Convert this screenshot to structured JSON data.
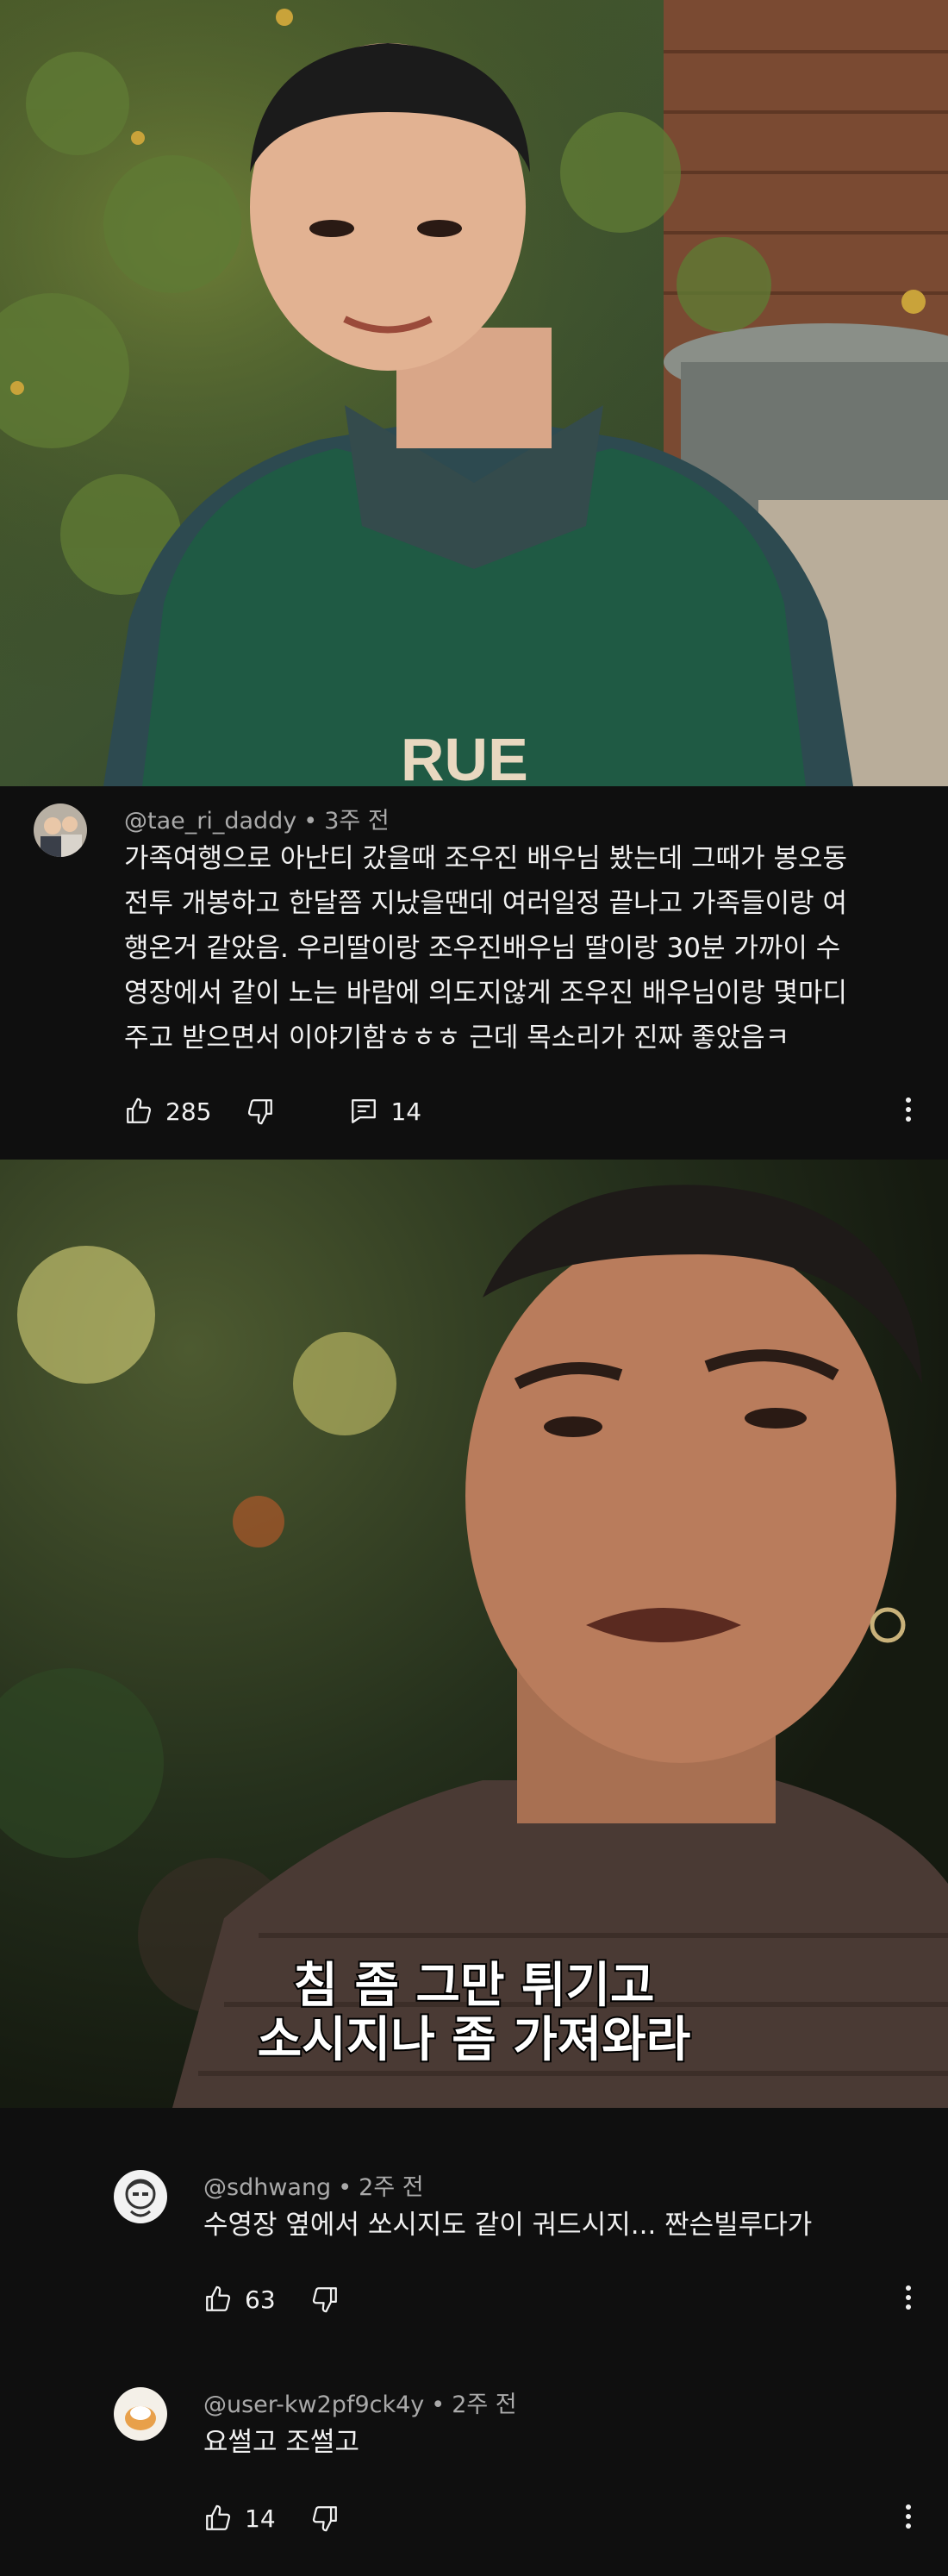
{
  "comments": [
    {
      "author": "@tae_ri_daddy",
      "time": "3주 전",
      "lines": [
        "가족여행으로 아난티 갔을때 조우진 배우님 봤는데 그때가 봉오동",
        "전투 개봉하고 한달쯤 지났을땐데 여러일정 끝나고 가족들이랑 여",
        "행온거 같았음. 우리딸이랑 조우진배우님 딸이랑 30분 가까이 수",
        "영장에서 같이 노는 바람에 의도지않게 조우진 배우님이랑 몇마디",
        "주고 받으면서 이야기함ㅎㅎㅎ 근데 목소리가 진짜 좋았음ㅋ"
      ],
      "likes": "285",
      "replies": "14"
    },
    {
      "author": "@sdhwang",
      "time": "2주 전",
      "lines": [
        "수영장 옆에서 쏘시지도 같이 궈드시지... 짠슨빌루다가"
      ],
      "likes": "63"
    },
    {
      "author": "@user-kw2pf9ck4y",
      "time": "2주 전",
      "lines": [
        "요썰고 조썰고"
      ],
      "likes": "14"
    }
  ],
  "photo2": {
    "subtitle_lines": [
      "침 좀 그만 튀기고",
      "소시지나 좀 가져와라"
    ]
  },
  "colors": {
    "background": "#0f0f0f",
    "text": "#f1f1f1",
    "meta": "#aaaaaa"
  },
  "icons": [
    "thumbs-up-icon",
    "thumbs-down-icon",
    "reply-icon",
    "more-vert-icon"
  ]
}
